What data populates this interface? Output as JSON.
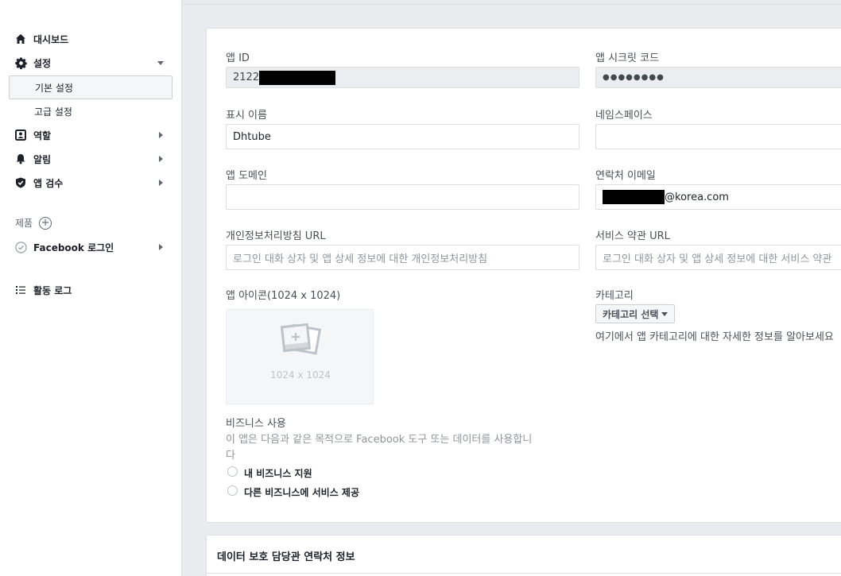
{
  "sidebar": {
    "dashboard": "대시보드",
    "settings": "설정",
    "settings_basic": "기본 설정",
    "settings_advanced": "고급 설정",
    "roles": "역할",
    "alerts": "알림",
    "app_review": "앱 검수",
    "products_label": "제품",
    "facebook_login": "Facebook 로그인",
    "activity_log": "활동 로그"
  },
  "form": {
    "app_id_label": "앱 ID",
    "app_id_value": "2122",
    "app_secret_label": "앱 시크릿 코드",
    "app_secret_value": "●●●●●●●●",
    "display_name_label": "표시 이름",
    "display_name_value": "Dhtube",
    "namespace_label": "네임스페이스",
    "namespace_value": "",
    "app_domain_label": "앱 도메인",
    "app_domain_value": "",
    "contact_email_label": "연락처 이메일",
    "contact_email_suffix": "@korea.com",
    "privacy_url_label": "개인정보처리방침 URL",
    "privacy_url_placeholder": "로그인 대화 상자 및 앱 상세 정보에 대한 개인정보처리방침",
    "terms_url_label": "서비스 약관 URL",
    "terms_url_placeholder": "로그인 대화 상자 및 앱 상세 정보에 대한 서비스 약관",
    "app_icon_label": "앱 아이콘(1024 x 1024)",
    "app_icon_placeholder": "1024 x 1024",
    "category_label": "카테고리",
    "category_button": "카테고리 선택",
    "category_help": "여기에서 앱 카테고리에 대한 자세한 정보를 알아보세요",
    "business_use_label": "비즈니스 사용",
    "business_use_desc_line1": "이 앱은 다음과 같은 목적으로 Facebook 도구 또는 데이터를 사용합니",
    "business_use_desc_line2": "다",
    "radio_own_business": "내 비즈니스 지원",
    "radio_other_business": "다른 비즈니스에 서비스 제공"
  },
  "dpo_section": {
    "title": "데이터 보호 담당관 연락처 정보"
  }
}
